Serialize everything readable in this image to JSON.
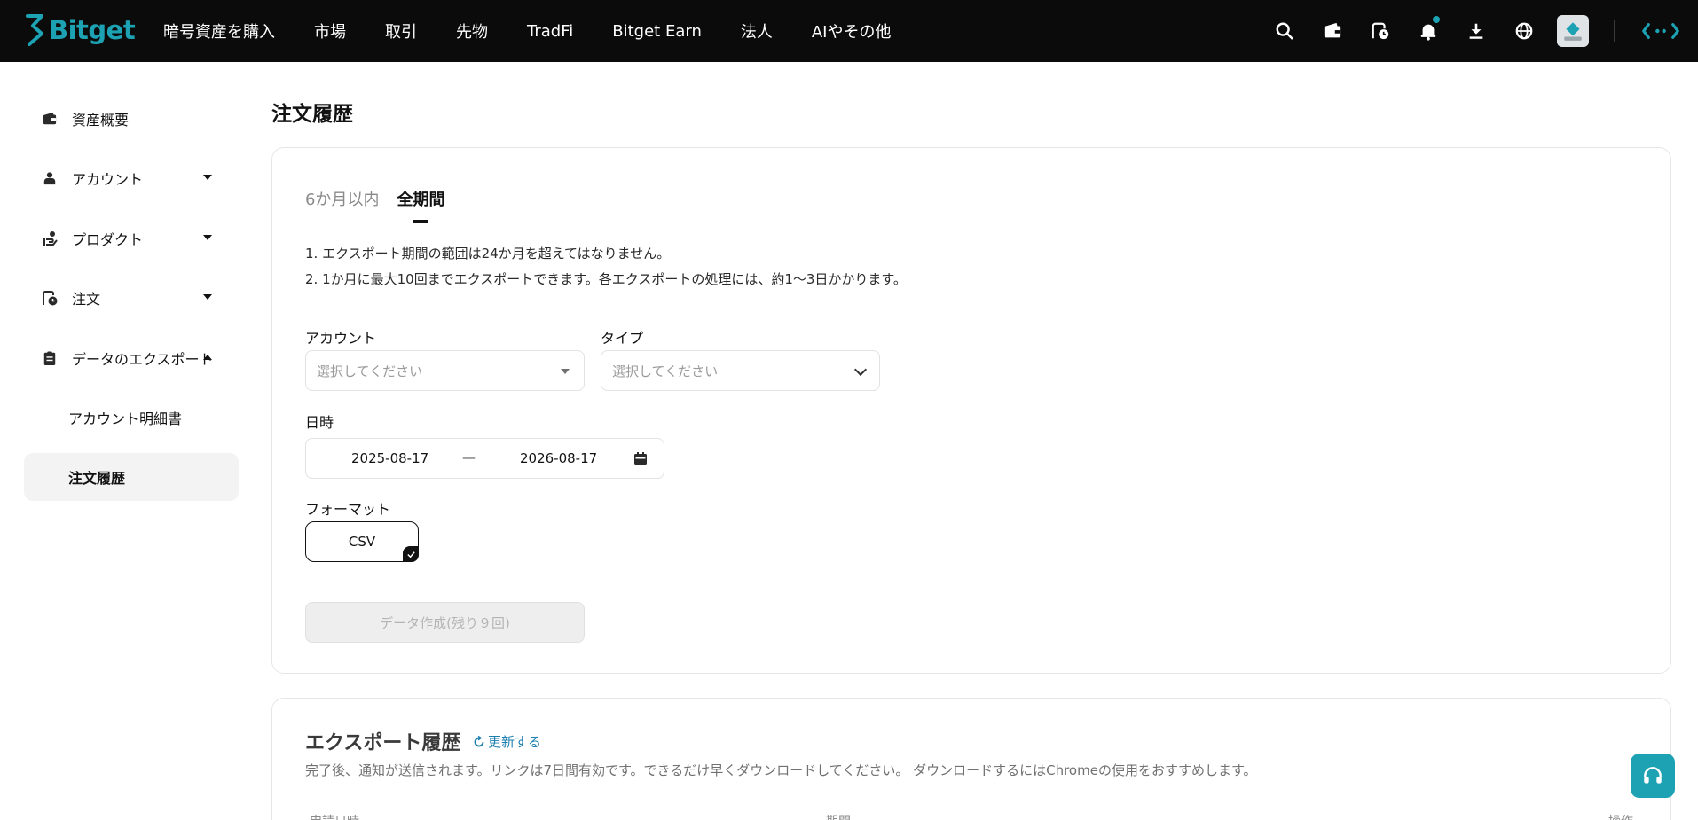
{
  "brand": {
    "name": "Bitget",
    "accent": "#1da2b4"
  },
  "topnav": {
    "items": [
      "暗号資産を購入",
      "市場",
      "取引",
      "先物",
      "TradFi",
      "Bitget Earn",
      "法人",
      "AIやその他"
    ]
  },
  "sidebar": {
    "items": [
      {
        "label": "資産概要",
        "icon": "wallet-icon"
      },
      {
        "label": "アカウント",
        "icon": "user-icon"
      },
      {
        "label": "プロダクト",
        "icon": "product-icon"
      },
      {
        "label": "注文",
        "icon": "order-clock-icon"
      },
      {
        "label": "データのエクスポート",
        "icon": "clipboard-icon"
      }
    ],
    "sub_items": [
      "アカウント明細書",
      "注文履歴"
    ]
  },
  "page": {
    "title": "注文履歴"
  },
  "form": {
    "tabs": [
      "6か月以内",
      "全期間"
    ],
    "notes": [
      "1. エクスポート期間の範囲は24か月を超えてはなりません。",
      "2. 1か月に最大10回までエクスポートできます。各エクスポートの処理には、約1〜3日かかります。"
    ],
    "account_label": "アカウント",
    "account_placeholder": "選択してください",
    "type_label": "タイプ",
    "type_placeholder": "選択してください",
    "date_label": "日時",
    "date_from": "2025-08-17",
    "date_sep": "—",
    "date_to": "2026-08-17",
    "format_label": "フォーマット",
    "format_value": "CSV",
    "generate_label": "データ作成(残り９回)"
  },
  "history": {
    "title": "エクスポート履歴",
    "refresh_label": "更新する",
    "description": "完了後、通知が送信されます。リンクは7日間有効です。できるだけ早くダウンロードしてください。 ダウンロードするにはChromeの使用をおすすめします。",
    "columns": [
      "申請日時",
      "期間",
      "操作"
    ]
  }
}
